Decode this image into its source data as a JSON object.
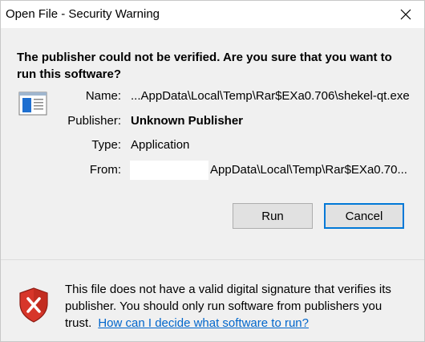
{
  "window": {
    "title": "Open File - Security Warning"
  },
  "heading": "The publisher could not be verified.  Are you sure that you want to run this software?",
  "fields": {
    "name_label": "Name:",
    "name_value": "...AppData\\Local\\Temp\\Rar$EXa0.706\\shekel-qt.exe",
    "publisher_label": "Publisher:",
    "publisher_value": "Unknown Publisher",
    "type_label": "Type:",
    "type_value": "Application",
    "from_label": "From:",
    "from_value": "AppData\\Local\\Temp\\Rar$EXa0.70..."
  },
  "buttons": {
    "run": "Run",
    "cancel": "Cancel"
  },
  "footer": {
    "message": "This file does not have a valid digital signature that verifies its publisher.  You should only run software from publishers you trust.",
    "link": "How can I decide what software to run?"
  },
  "icons": {
    "app": "application-window-icon",
    "shield": "security-shield-error-icon",
    "close": "close-icon"
  },
  "colors": {
    "accent": "#0078d7",
    "link": "#0066cc",
    "shield_red": "#c42b1c"
  }
}
